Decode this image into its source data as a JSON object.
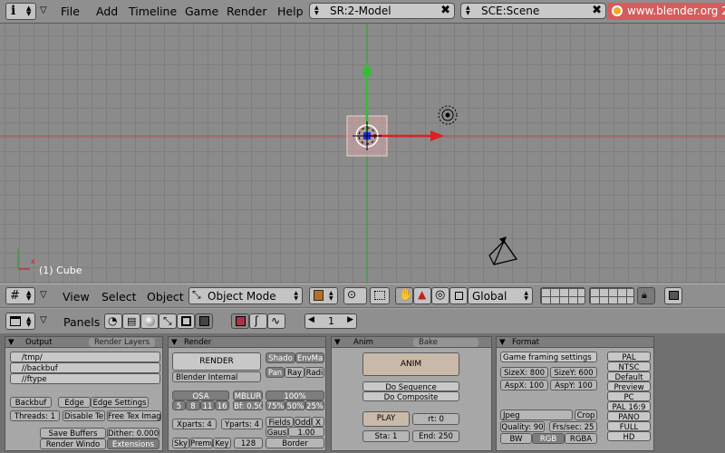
{
  "topbar": {
    "menus": [
      "File",
      "Add",
      "Timeline",
      "Game",
      "Render",
      "Help"
    ],
    "screen_field": "SR:2-Model",
    "scene_field": "SCE:Scene",
    "url": "www.blender.org 2"
  },
  "viewport": {
    "object_label": "(1) Cube",
    "axis_x": "x"
  },
  "view_header": {
    "menus": [
      "View",
      "Select",
      "Object"
    ],
    "mode": "Object Mode",
    "orientation": "Global"
  },
  "buttons_header": {
    "panels_label": "Panels",
    "frame": "1"
  },
  "output_panel": {
    "tab_active": "Output",
    "tab_inactive": "Render Layers",
    "paths": [
      "/tmp/",
      "//backbuf",
      "//ftype"
    ],
    "backbuf": "Backbuf",
    "edge": "Edge",
    "edge_settings": "Edge Settings",
    "threads": "Threads: 1",
    "disable_tex": "Disable Te",
    "free_tex": "Free Tex Imag",
    "save_buffers": "Save Buffers",
    "dither": "Dither: 0.000",
    "render_window": "Render Windo",
    "extensions": "Extensions"
  },
  "render_panel": {
    "title": "Render",
    "render_btn": "RENDER",
    "engine": "Blender Internal",
    "shadow": "Shado",
    "envmap": "EnvMa",
    "pan": "Pan",
    "ray": "Ray",
    "radio": "Radi",
    "osa": "OSA",
    "osa_values": [
      "5",
      "8",
      "11",
      "16"
    ],
    "mblur": "MBLUR",
    "bf": "Bf: 0.50",
    "pct": "100%",
    "pct_values": [
      "75%",
      "50%",
      "25%"
    ],
    "xparts": "Xparts: 4",
    "yparts": "Yparts: 4",
    "fields": "Fields",
    "odd": "Odd",
    "x": "X",
    "gauss": "Gaus",
    "gauss_val": "1.00",
    "sky": "Sky",
    "premul": "Premu",
    "key": "Key",
    "size": "128",
    "border": "Border"
  },
  "anim_panel": {
    "tab_active": "Anim",
    "tab_inactive": "Bake",
    "anim_btn": "ANIM",
    "do_sequence": "Do Sequence",
    "do_composite": "Do Composite",
    "play": "PLAY",
    "rt": "rt: 0",
    "sta": "Sta: 1",
    "end": "End: 250"
  },
  "format_panel": {
    "title": "Format",
    "game_framing": "Game framing settings",
    "sizex": "SizeX: 800",
    "sizey": "SizeY: 600",
    "aspx": "AspX: 100",
    "aspy": "AspY: 100",
    "format": "Jpeg",
    "crop": "Crop",
    "quality": "Quality: 90",
    "fps": "Frs/sec: 25",
    "bw": "BW",
    "rgb": "RGB",
    "rgba": "RGBA",
    "presets": [
      "PAL",
      "NTSC",
      "Default",
      "Preview",
      "PC",
      "PAL 16:9",
      "PANO",
      "FULL",
      "HD"
    ]
  },
  "colors": {
    "grid_bg": "#8b8b8b",
    "x_axis": "#d22222",
    "y_axis": "#22b022",
    "url_bg": "#d65c5c"
  }
}
